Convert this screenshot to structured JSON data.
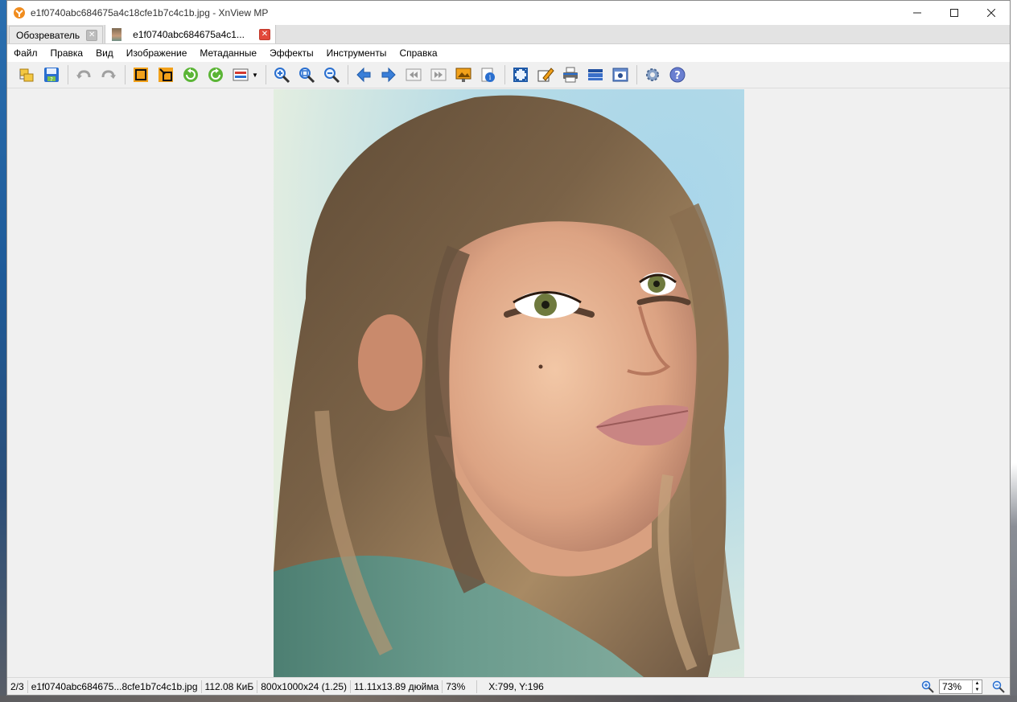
{
  "window": {
    "title": "e1f0740abc684675a4c18cfe1b7c4c1b.jpg - XnView MP"
  },
  "tabs": [
    {
      "label": "Обозреватель"
    },
    {
      "label": "e1f0740abc684675a4c1..."
    }
  ],
  "menu": [
    "Файл",
    "Правка",
    "Вид",
    "Изображение",
    "Метаданные",
    "Эффекты",
    "Инструменты",
    "Справка"
  ],
  "toolbar": {
    "icons": [
      "browser-icon",
      "save-icon",
      "undo-icon",
      "redo-icon",
      "crop-icon",
      "resize-icon",
      "rotate-left-icon",
      "rotate-right-icon",
      "adjust-icon",
      "zoom-in-icon",
      "zoom-fit-icon",
      "zoom-out-icon",
      "prev-icon",
      "next-icon",
      "first-icon",
      "last-icon",
      "slideshow-icon",
      "info-icon",
      "fullscreen-icon",
      "edit-icon",
      "print-icon",
      "scanner-icon",
      "capture-icon",
      "settings-icon",
      "help-icon"
    ]
  },
  "status": {
    "index": "2/3",
    "filename": "e1f0740abc684675...8cfe1b7c4c1b.jpg",
    "filesize": "112.08 КиБ",
    "dimensions": "800x1000x24 (1.25)",
    "print_size": "11.11x13.89 дюйма",
    "zoom": "73%",
    "coords": "X:799, Y:196",
    "zoom_field": "73%"
  },
  "colors": {
    "accent_red": "#e2483a",
    "toolbar_blue": "#2a6fcf"
  }
}
